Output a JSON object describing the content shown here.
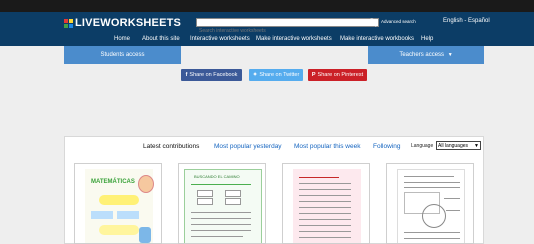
{
  "brand": {
    "name": "LIVEWORKSHEETS",
    "square_colors": [
      "#e53935",
      "#fdd835",
      "#43a047",
      "#1e88e5"
    ]
  },
  "colors": {
    "header_bg": "#0c3d66",
    "access_bar": "#4b8ccc",
    "facebook": "#3b5998",
    "twitter": "#55acee",
    "pinterest": "#cb2027",
    "link_blue": "#1565c0"
  },
  "search": {
    "placeholder": "Search interactive worksheets",
    "button_icon": "search-icon",
    "advanced_label": "Advanced search"
  },
  "language_switch": "English - Español",
  "nav": {
    "items": [
      "Home",
      "About this site",
      "Interactive worksheets",
      "Make interactive worksheets",
      "Make interactive workbooks",
      "Help"
    ]
  },
  "access": {
    "students": "Students access",
    "teachers": "Teachers access"
  },
  "share": {
    "facebook": "Share on Facebook",
    "twitter": "Share on Twitter",
    "pinterest": "Share on Pinterest"
  },
  "contributions": {
    "tabs": [
      "Latest contributions",
      "Most popular yesterday",
      "Most popular this week",
      "Following"
    ],
    "language_label": "Language",
    "language_value": "All languages"
  },
  "worksheets": [
    {
      "title": "MATEMÁTICAS"
    },
    {
      "title": "BUSCANDO EL CAMINO"
    },
    {
      "title": ""
    },
    {
      "title": ""
    }
  ]
}
